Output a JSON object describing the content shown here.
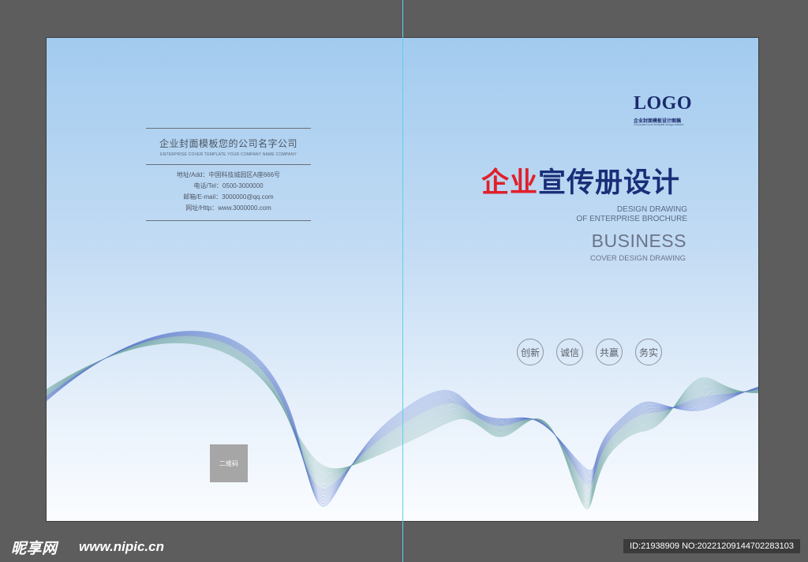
{
  "back_cover": {
    "company_name": "企业封面模板您的公司名字公司",
    "company_sub": "ENTERPRISE COVER TEMPLATE YOUR COMPANY NAME COMPANY",
    "contacts": [
      "地址/Add：中国科技城园区A座666号",
      "电话/Tel：0500-3000000",
      "邮箱/E-mail：3000000@qq.com",
      "网址/Http：www.3000000.com"
    ],
    "qr_label": "二维码"
  },
  "front_cover": {
    "logo": "LOGO",
    "logo_sub": "企业封面模板设计图稿",
    "logo_sub2": "Corporate cover template design artwork",
    "headline_red": "企业",
    "headline_blue": "宣传册设计",
    "design_line1": "DESIGN DRAWING",
    "design_line2": "OF ENTERPRISE BROCHURE",
    "business": "BUSINESS",
    "business_sub": "COVER DESIGN DRAWING",
    "values": [
      "创新",
      "诚信",
      "共赢",
      "务实"
    ]
  },
  "watermark": {
    "site_logo": "昵享网",
    "site_url": "www.nipic.cn",
    "id_text": "ID:21938909 NO:20221209144702283103"
  },
  "colors": {
    "headline_red": "#e0202a",
    "headline_blue": "#1a2e78",
    "background_top": "#a2cbef",
    "background_bottom": "#fbfdff",
    "guide": "#5ad1ee"
  }
}
